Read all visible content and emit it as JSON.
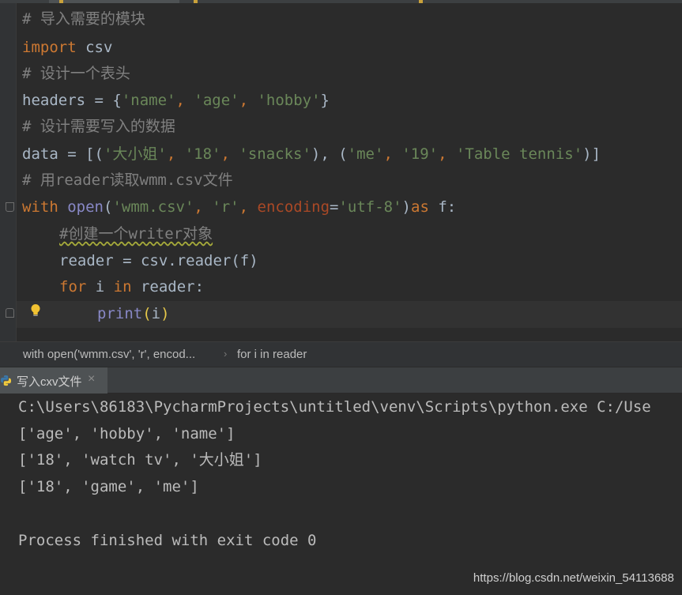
{
  "editor": {
    "lines": {
      "l1_comment": "# 导入需要的模块",
      "l2_kw": "import",
      "l2_rest": " csv",
      "l3_comment": "# 设计一个表头",
      "l4_a": "headers = {",
      "l4_s1": "'name'",
      "l4_c1": ", ",
      "l4_s2": "'age'",
      "l4_c2": ", ",
      "l4_s3": "'hobby'",
      "l4_b": "}",
      "l5_comment": "# 设计需要写入的数据",
      "l6_a": "data = [(",
      "l6_s1": "'大小姐'",
      "l6_c1": ", ",
      "l6_s2": "'18'",
      "l6_c2": ", ",
      "l6_s3": "'snacks'",
      "l6_b": "), (",
      "l6_s4": "'me'",
      "l6_c3": ", ",
      "l6_s5": "'19'",
      "l6_c4": ", ",
      "l6_s6": "'Table tennis'",
      "l6_e": ")]",
      "l7_comment": "# 用reader读取wmm.csv文件",
      "l8_kw1": "with",
      "l8_sp": " ",
      "l8_open": "open",
      "l8_p1": "(",
      "l8_s1": "'wmm.csv'",
      "l8_c1": ", ",
      "l8_s2": "'r'",
      "l8_c2": ", ",
      "l8_param": "encoding",
      "l8_eq": "=",
      "l8_s3": "'utf-8'",
      "l8_p2": ")",
      "l8_kw2": "as",
      "l8_rest": " f:",
      "l9_comment": "#创建一个writer对象",
      "l10": "reader = csv.reader(f)",
      "l11_kw1": "for",
      "l11_a": " i ",
      "l11_kw2": "in",
      "l11_b": " reader:",
      "l12_print": "print",
      "l12_p1": "(",
      "l12_i": "i",
      "l12_p2": ")"
    }
  },
  "breadcrumb": {
    "item1": "with open('wmm.csv', 'r', encod...",
    "separator": "›",
    "item2": "for i in reader"
  },
  "run_panel": {
    "tab_label": "写入cxv文件",
    "close_glyph": "×",
    "icon": "python-icon"
  },
  "console": {
    "lines": [
      "C:\\Users\\86183\\PycharmProjects\\untitled\\venv\\Scripts\\python.exe C:/Use",
      "['age', 'hobby', 'name']",
      "['18', 'watch tv', '大小姐']",
      "['18', 'game', 'me']",
      "",
      "Process finished with exit code 0"
    ]
  },
  "watermark": "https://blog.csdn.net/weixin_54113688",
  "colors": {
    "background": "#2b2b2b",
    "keyword": "#cc7832",
    "string": "#6a8759",
    "comment": "#808080",
    "builtin": "#8888c6",
    "parameter": "#aa4926"
  }
}
